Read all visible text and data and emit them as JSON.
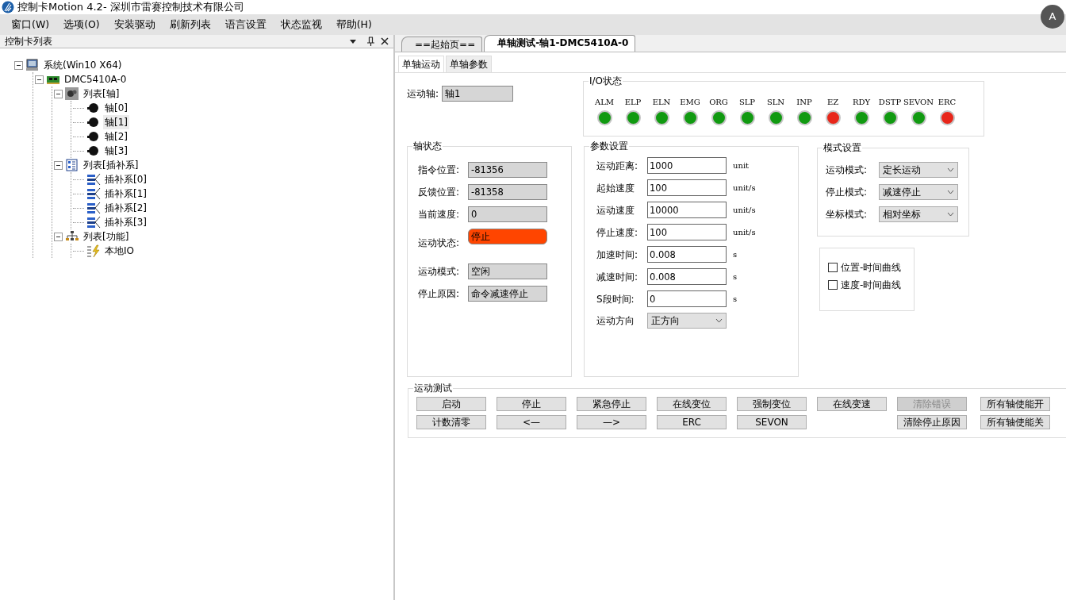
{
  "window": {
    "title": "控制卡Motion 4.2- 深圳市雷赛控制技术有限公司"
  },
  "overlay_button": {
    "label": "A"
  },
  "menu": [
    "窗口(W)",
    "选项(O)",
    "安装驱动",
    "刷新列表",
    "语言设置",
    "状态监视",
    "帮助(H)"
  ],
  "sidebar": {
    "title": "控制卡列表",
    "tree": [
      {
        "label": "系统(Win10 X64)",
        "kind": "computer",
        "selected": false,
        "expanded": true,
        "children": [
          {
            "label": "DMC5410A-0",
            "kind": "card",
            "selected": false,
            "expanded": true,
            "children": [
              {
                "label": "列表[轴]",
                "kind": "axis-list",
                "selected": false,
                "expanded": true,
                "children": [
                  {
                    "label": "轴[0]",
                    "kind": "motor",
                    "selected": false
                  },
                  {
                    "label": "轴[1]",
                    "kind": "motor",
                    "selected": true
                  },
                  {
                    "label": "轴[2]",
                    "kind": "motor",
                    "selected": false
                  },
                  {
                    "label": "轴[3]",
                    "kind": "motor",
                    "selected": false
                  }
                ]
              },
              {
                "label": "列表[插补系]",
                "kind": "interp-list",
                "selected": false,
                "expanded": true,
                "children": [
                  {
                    "label": "插补系[0]",
                    "kind": "interp",
                    "selected": false
                  },
                  {
                    "label": "插补系[1]",
                    "kind": "interp",
                    "selected": false
                  },
                  {
                    "label": "插补系[2]",
                    "kind": "interp",
                    "selected": false
                  },
                  {
                    "label": "插补系[3]",
                    "kind": "interp",
                    "selected": false
                  }
                ]
              },
              {
                "label": "列表[功能]",
                "kind": "func-list",
                "selected": false,
                "expanded": true,
                "children": [
                  {
                    "label": "本地IO",
                    "kind": "io",
                    "selected": false
                  }
                ]
              }
            ]
          }
        ]
      }
    ]
  },
  "doc_tabs": [
    {
      "label": "==起始页==",
      "selected": false
    },
    {
      "label": "单轴测试-轴1-DMC5410A-0",
      "selected": true
    }
  ],
  "sub_tabs": [
    {
      "label": "单轴运动",
      "selected": true
    },
    {
      "label": "单轴参数",
      "selected": false
    }
  ],
  "axis": {
    "label": "运动轴:",
    "value": "轴1"
  },
  "io_status": {
    "title": "I/O状态",
    "signals": [
      {
        "label": "ALM",
        "color": "#119a11"
      },
      {
        "label": "ELP",
        "color": "#119a11"
      },
      {
        "label": "ELN",
        "color": "#119a11"
      },
      {
        "label": "EMG",
        "color": "#119a11"
      },
      {
        "label": "ORG",
        "color": "#119a11"
      },
      {
        "label": "SLP",
        "color": "#119a11"
      },
      {
        "label": "SLN",
        "color": "#119a11"
      },
      {
        "label": "INP",
        "color": "#119a11"
      },
      {
        "label": "EZ",
        "color": "#e8261a"
      },
      {
        "label": "RDY",
        "color": "#119a11"
      },
      {
        "label": "DSTP",
        "color": "#119a11"
      },
      {
        "label": "SEVON",
        "color": "#119a11"
      },
      {
        "label": "ERC",
        "color": "#e8261a"
      }
    ]
  },
  "axis_status": {
    "title": "轴状态",
    "fields": [
      {
        "label": "指令位置:",
        "value": "-81356",
        "alert": false
      },
      {
        "label": "反馈位置:",
        "value": "-81358",
        "alert": false
      },
      {
        "label": "当前速度:",
        "value": "0",
        "alert": false
      },
      {
        "label": "运动状态:",
        "value": "停止",
        "alert": true
      },
      {
        "label": "运动模式:",
        "value": "空闲",
        "alert": false
      },
      {
        "label": "停止原因:",
        "value": "命令减速停止",
        "alert": false
      }
    ]
  },
  "params": {
    "title": "参数设置",
    "fields": [
      {
        "label": "运动距离:",
        "value": "1000",
        "unit": "unit",
        "kind": "input"
      },
      {
        "label": "起始速度",
        "value": "100",
        "unit": "unit/s",
        "kind": "input"
      },
      {
        "label": "运动速度",
        "value": "10000",
        "unit": "unit/s",
        "kind": "input"
      },
      {
        "label": "停止速度:",
        "value": "100",
        "unit": "unit/s",
        "kind": "input"
      },
      {
        "label": "加速时间:",
        "value": "0.008",
        "unit": "s",
        "kind": "input"
      },
      {
        "label": "减速时间:",
        "value": "0.008",
        "unit": "s",
        "kind": "input"
      },
      {
        "label": "S段时间:",
        "value": "0",
        "unit": "s",
        "kind": "input"
      },
      {
        "label": "运动方向",
        "value": "正方向",
        "kind": "select"
      }
    ]
  },
  "mode": {
    "title": "模式设置",
    "fields": [
      {
        "label": "运动模式:",
        "value": "定长运动"
      },
      {
        "label": "停止模式:",
        "value": "减速停止"
      },
      {
        "label": "坐标模式:",
        "value": "相对坐标"
      }
    ]
  },
  "curves": [
    {
      "label": "位置-时间曲线",
      "checked": false
    },
    {
      "label": "速度-时间曲线",
      "checked": false
    }
  ],
  "motion_test": {
    "title": "运动测试",
    "rows": [
      {
        "left": [
          {
            "label": "启动",
            "disabled": false
          },
          {
            "label": "停止",
            "disabled": false
          },
          {
            "label": "紧急停止",
            "disabled": false
          },
          {
            "label": "在线变位",
            "disabled": false
          },
          {
            "label": "强制变位",
            "disabled": false
          },
          {
            "label": "在线变速",
            "disabled": false
          }
        ],
        "right": [
          {
            "label": "清除错误",
            "disabled": true
          },
          {
            "label": "所有轴使能开",
            "disabled": false
          }
        ]
      },
      {
        "left": [
          {
            "label": "计数清零",
            "disabled": false
          },
          {
            "label": "<—",
            "disabled": false
          },
          {
            "label": "—>",
            "disabled": false
          },
          {
            "label": "ERC",
            "disabled": false
          },
          {
            "label": "SEVON",
            "disabled": false
          }
        ],
        "right": [
          {
            "label": "清除停止原因",
            "disabled": false
          },
          {
            "label": "所有轴使能关",
            "disabled": false
          }
        ]
      }
    ]
  }
}
